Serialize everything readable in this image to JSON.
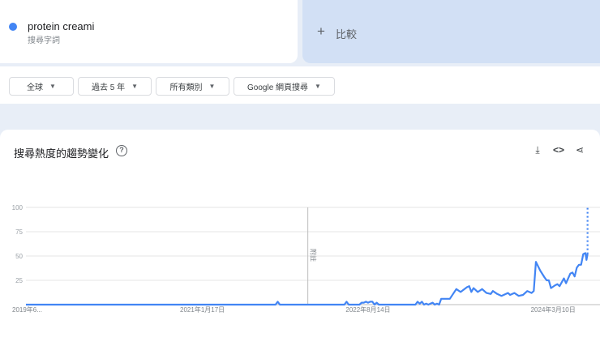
{
  "term": {
    "name": "protein creami",
    "type": "搜尋字詞",
    "color": "#4285f4"
  },
  "compare": {
    "label": "比較"
  },
  "filters": [
    {
      "label": "全球"
    },
    {
      "label": "過去 5 年"
    },
    {
      "label": "所有類別"
    },
    {
      "label": "Google 網頁搜尋"
    }
  ],
  "chart_card": {
    "title": "搜尋熱度的趨勢變化",
    "help": "?"
  },
  "chart_data": {
    "type": "line",
    "title": "搜尋熱度的趨勢變化",
    "xlabel": "",
    "ylabel": "",
    "ylim": [
      0,
      100
    ],
    "yticks": [
      "100",
      "75",
      "50",
      "25"
    ],
    "ytick_values": [
      100,
      75,
      50,
      25
    ],
    "x_unit": "week index",
    "xlim": [
      0,
      260
    ],
    "xticks": [
      {
        "week": 0,
        "label": "2019年6..."
      },
      {
        "week": 82,
        "label": "2021年1月17日"
      },
      {
        "week": 159,
        "label": "2022年8月14日"
      },
      {
        "week": 245,
        "label": "2024年3月10日"
      }
    ],
    "annotation": {
      "week": 131,
      "label": "附註"
    },
    "series": [
      {
        "name": "protein creami",
        "color": "#4285f4",
        "points": [
          [
            0,
            0
          ],
          [
            116,
            0
          ],
          [
            117,
            3
          ],
          [
            118,
            0
          ],
          [
            148,
            0
          ],
          [
            149,
            3
          ],
          [
            150,
            0
          ],
          [
            155,
            0
          ],
          [
            156,
            2
          ],
          [
            157,
            2
          ],
          [
            158,
            3
          ],
          [
            159,
            2
          ],
          [
            160,
            3
          ],
          [
            161,
            3
          ],
          [
            162,
            0
          ],
          [
            163,
            2
          ],
          [
            164,
            0
          ],
          [
            181,
            0
          ],
          [
            182,
            3
          ],
          [
            183,
            1
          ],
          [
            184,
            3
          ],
          [
            185,
            0
          ],
          [
            186,
            1
          ],
          [
            187,
            0
          ],
          [
            188,
            1
          ],
          [
            189,
            2
          ],
          [
            190,
            0
          ],
          [
            191,
            1
          ],
          [
            192,
            0
          ],
          [
            193,
            6
          ],
          [
            195,
            6
          ],
          [
            197,
            6
          ],
          [
            200,
            16
          ],
          [
            202,
            13
          ],
          [
            205,
            18
          ],
          [
            206,
            19
          ],
          [
            207,
            13
          ],
          [
            208,
            17
          ],
          [
            210,
            13
          ],
          [
            212,
            16
          ],
          [
            214,
            12
          ],
          [
            216,
            11
          ],
          [
            217,
            14
          ],
          [
            219,
            11
          ],
          [
            221,
            9
          ],
          [
            224,
            12
          ],
          [
            225,
            10
          ],
          [
            227,
            12
          ],
          [
            229,
            9
          ],
          [
            231,
            10
          ],
          [
            233,
            14
          ],
          [
            235,
            12
          ],
          [
            236,
            14
          ],
          [
            237,
            44
          ],
          [
            239,
            35
          ],
          [
            241,
            28
          ],
          [
            242,
            25
          ],
          [
            243,
            25
          ],
          [
            244,
            17
          ],
          [
            246,
            20
          ],
          [
            247,
            21
          ],
          [
            248,
            19
          ],
          [
            250,
            27
          ],
          [
            251,
            22
          ],
          [
            253,
            32
          ],
          [
            254,
            33
          ],
          [
            255,
            29
          ],
          [
            256,
            38
          ],
          [
            257,
            41
          ],
          [
            258,
            41
          ],
          [
            259,
            52
          ],
          [
            260,
            53
          ],
          [
            260.5,
            46
          ],
          [
            261,
            52
          ]
        ],
        "partial": [
          [
            261,
            52
          ],
          [
            261,
            100
          ]
        ]
      }
    ]
  }
}
